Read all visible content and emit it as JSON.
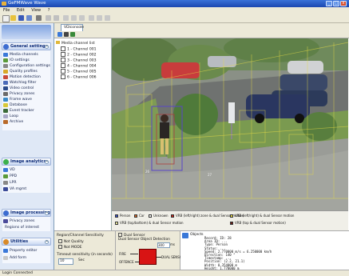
{
  "window": {
    "title": "GeFMWave Wave",
    "minimize": "_",
    "maximize": "□",
    "close": "x"
  },
  "menu": [
    "File",
    "Edit",
    "View",
    "?"
  ],
  "sidebar": {
    "sections": [
      {
        "title": "General settings",
        "items": [
          "Media channels",
          "IO settings",
          "Configuration settings",
          "Quality profiles",
          "Motion detection",
          "Watchlog filter",
          "Video control",
          "Privacy zones",
          "Frame wave",
          "Database",
          "Event tracker",
          "Loop",
          "Archive"
        ]
      },
      {
        "title": "Image analytics",
        "items": [
          "VD",
          "PPD",
          "LPR",
          "VA mgmt"
        ]
      },
      {
        "title": "Image processing",
        "items": [
          "Privacy zones",
          "Regions of interest"
        ]
      },
      {
        "title": "Utilities",
        "items": [
          "Property editor",
          "Add form"
        ]
      }
    ]
  },
  "tab": {
    "label": "VDiconsole"
  },
  "tree": {
    "root": "Media channel list",
    "items": [
      "1 - Channel 001",
      "2 - Channel 002",
      "3 - Channel 003",
      "4 - Channel 004",
      "5 - Channel 005",
      "6 - Channel 006"
    ]
  },
  "video": {
    "zone_label_a": "26",
    "zone_label_b": "27",
    "colors": {
      "zone": "#e6dc46",
      "track_outer": "#5a46c8",
      "track_inner": "#b03c3c"
    }
  },
  "legend": [
    {
      "label": "Person",
      "color": "#3a54c8"
    },
    {
      "label": "Car",
      "color": "#d86a28"
    },
    {
      "label": "Unknown",
      "color": "#ffffff"
    },
    {
      "label": "VRB (left/right) zone & dual Sensor motion",
      "color": "#c8281e"
    },
    {
      "label": "VRB (left/right) & dual Sensor motion",
      "color": "#e8d846"
    },
    {
      "label": "VRB (top/bottom) & dual Sensor motion",
      "color": "#f0f0a0"
    },
    {
      "label": "VRB (top & dual Sensor motion)",
      "color": "#6a1a12"
    }
  ],
  "properties": {
    "line1": "Region/Channel Sensitivity",
    "opt1": "Not Quality",
    "opt2": "Not MODE",
    "line2": "Timeout sensitivity (in seconds)",
    "value": "10",
    "unit": "Sec"
  },
  "editor": {
    "opt_a": "Dual Sensor",
    "opt_b": "Dual Sensor Object Detection",
    "spin_value": "300",
    "spin_unit": "ms",
    "in_a": "FIRE",
    "in_b": "OFFENCE",
    "block_out": "DUAL SENSOR",
    "colors": {
      "block": "#d81414"
    }
  },
  "console": {
    "title": "Objects",
    "lines": [
      "Record: ID: 28",
      "Area ID: ...",
      "Type: Person",
      "Status: ...",
      "Speed: 2.770000 m/s = 6.250000 km/h",
      "Direction: 140 °",
      "Timestamp: ...",
      "Position: (2.2, 21.1)",
      "Width: 0.354000 m",
      "Height: 1.770000 m"
    ]
  },
  "statusbar": {
    "text": "Login Connected"
  }
}
